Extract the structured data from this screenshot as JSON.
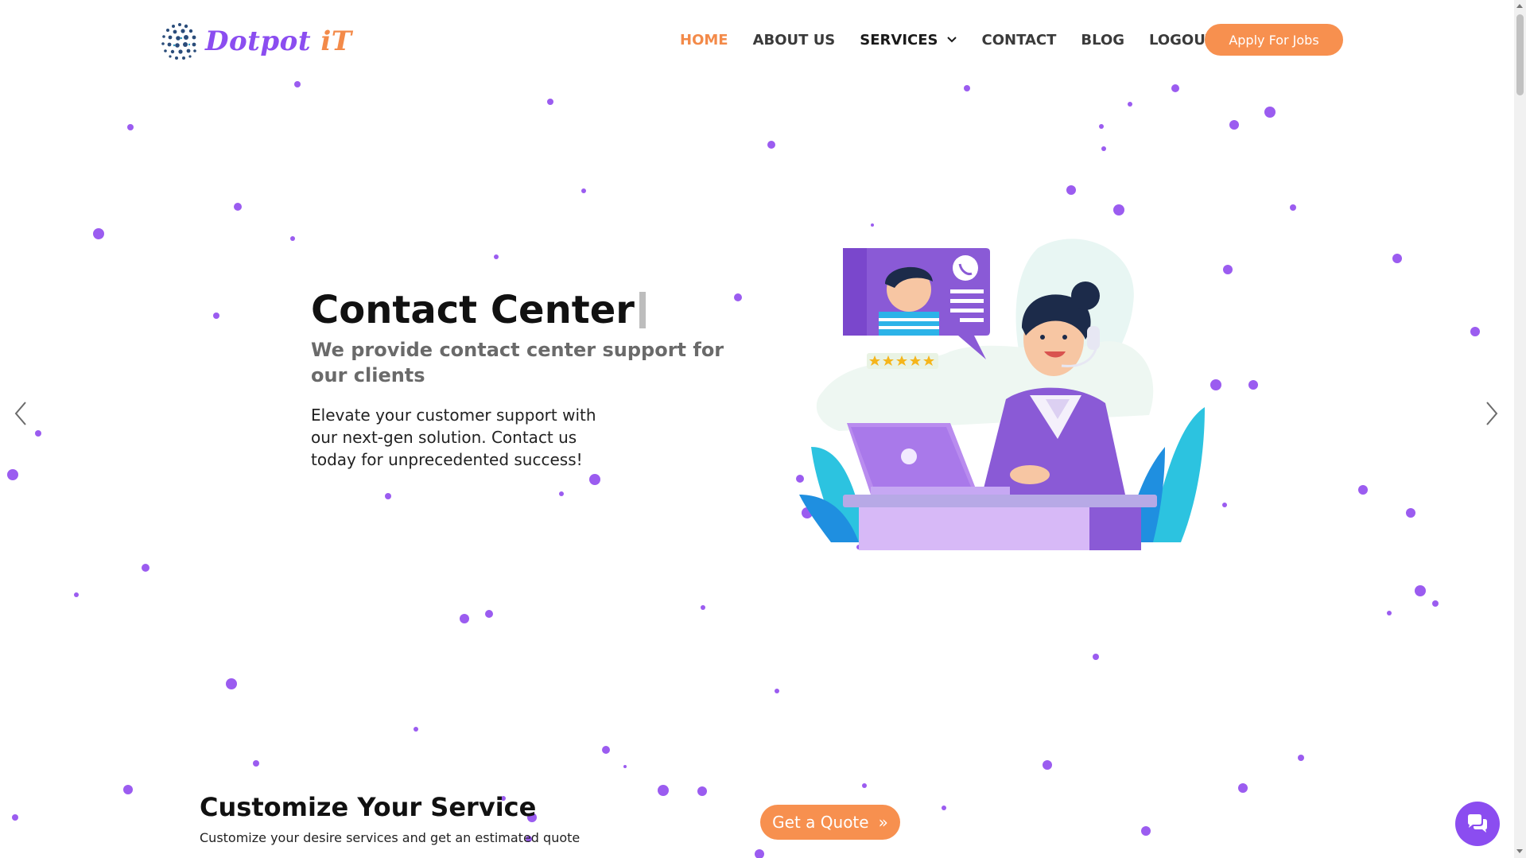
{
  "brand": {
    "logo_text_main": "Dotpot ",
    "logo_text_accent": "iT",
    "logo_icon": "dotted-globe-icon",
    "colors": {
      "purple": "#8b4df0",
      "orange": "#f7904f",
      "dot": "#9b5cf0"
    }
  },
  "nav": {
    "items": [
      {
        "label": "HOME",
        "active": true
      },
      {
        "label": "ABOUT US"
      },
      {
        "label": "SERVICES",
        "has_dropdown": true
      },
      {
        "label": "CONTACT"
      },
      {
        "label": "BLOG"
      },
      {
        "label": "LOGOUT"
      }
    ],
    "apply_label": "Apply For Jobs"
  },
  "hero": {
    "title": "Contact Center",
    "subtitle": "We provide contact center support for our clients",
    "description": "Elevate your customer support with our next-gen solution. Contact us today for unprecedented success!",
    "prev_icon": "chevron-left-icon",
    "next_icon": "chevron-right-icon",
    "illustration": "call-center-agent-illustration",
    "rating_stars": 5
  },
  "cta": {
    "title": "Customize Your Service",
    "description": "Customize your desire services and get an estimated quote",
    "button_label": "Get a Quote"
  },
  "chat": {
    "icon": "chat-bubbles-icon"
  }
}
